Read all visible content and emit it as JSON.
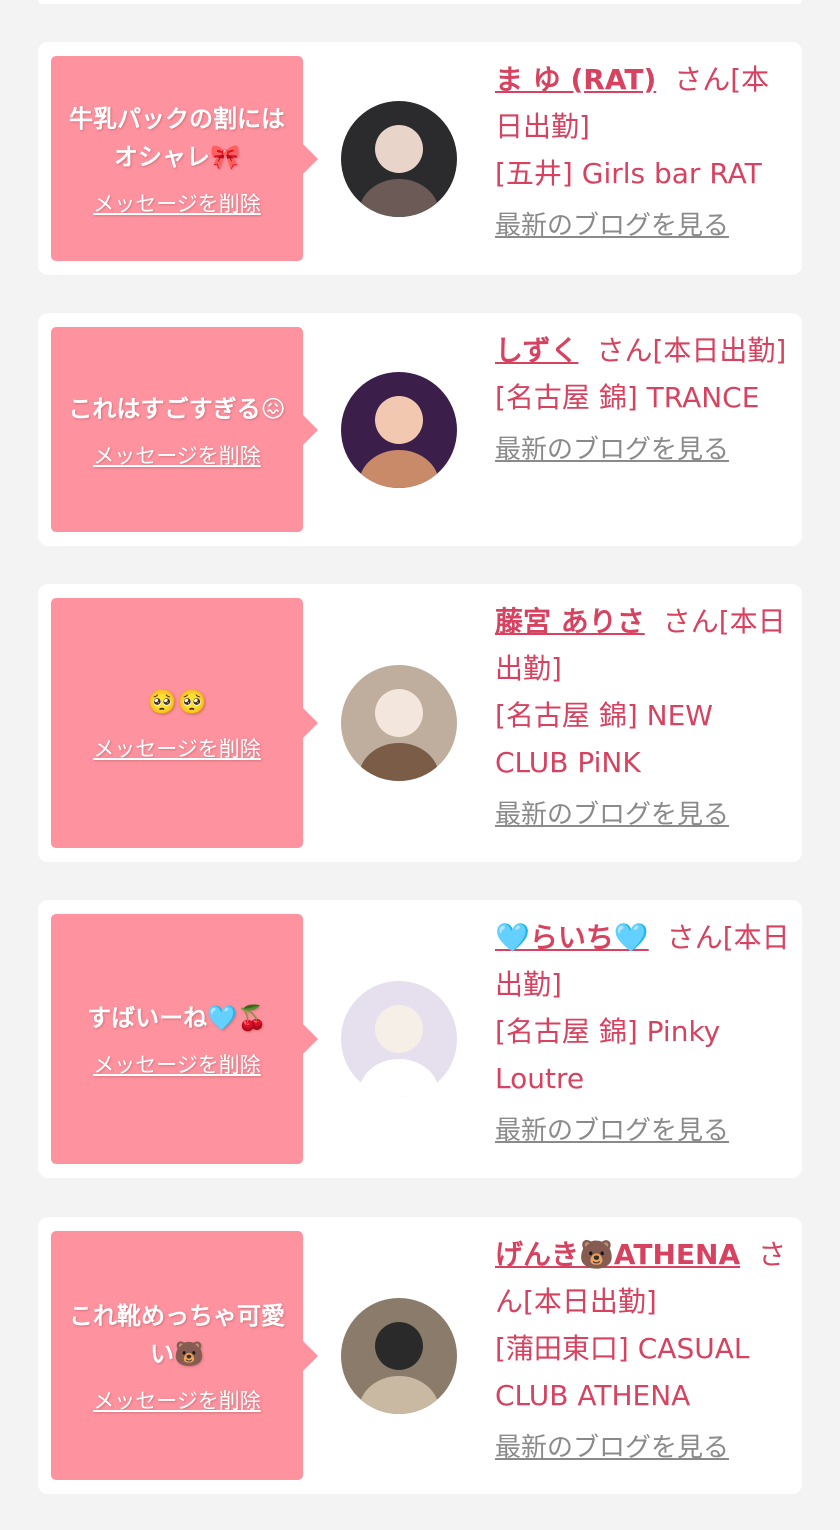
{
  "delete_label": "メッセージを削除",
  "blog_label": "最新のブログを見る",
  "items": [
    {
      "message": "牛乳パックの割にはオシャレ🎀",
      "name": "ま ゆ (RAT)",
      "suffix": "さん[本日出勤]",
      "shop": "[五井] Girls bar RAT",
      "avatar_palette": [
        "#2b2b2e",
        "#e8d4c8",
        "#6b5a55"
      ]
    },
    {
      "message": "これはすごすぎる😖",
      "name": "しずく",
      "suffix": "さん[本日出勤]",
      "shop": "[名古屋 錦] TRANCE",
      "avatar_palette": [
        "#3b1f4a",
        "#f2c9b0",
        "#c98a6a"
      ]
    },
    {
      "message": "🥺🥺",
      "name": "藤宮 ありさ",
      "suffix": "さん[本日出勤]",
      "shop": "[名古屋 錦] NEW CLUB PiNK",
      "avatar_palette": [
        "#bfae9e",
        "#f3e6dc",
        "#7a5c47"
      ]
    },
    {
      "message": "すばいーね🩵🍒",
      "name": "🩵らいち🩵",
      "suffix": "さん[本日出勤]",
      "shop": "[名古屋 錦] Pinky Loutre",
      "avatar_palette": [
        "#e6e0ee",
        "#f6efe8",
        "#ffffff"
      ]
    },
    {
      "message": "これ靴めっちゃ可愛い🐻",
      "name": "げんき🐻ATHENA",
      "suffix": "さん[本日出勤]",
      "shop": "[蒲田東口] CASUAL CLUB ATHENA",
      "avatar_palette": [
        "#8a7b6a",
        "#2a2a2a",
        "#c9b8a2"
      ]
    }
  ]
}
